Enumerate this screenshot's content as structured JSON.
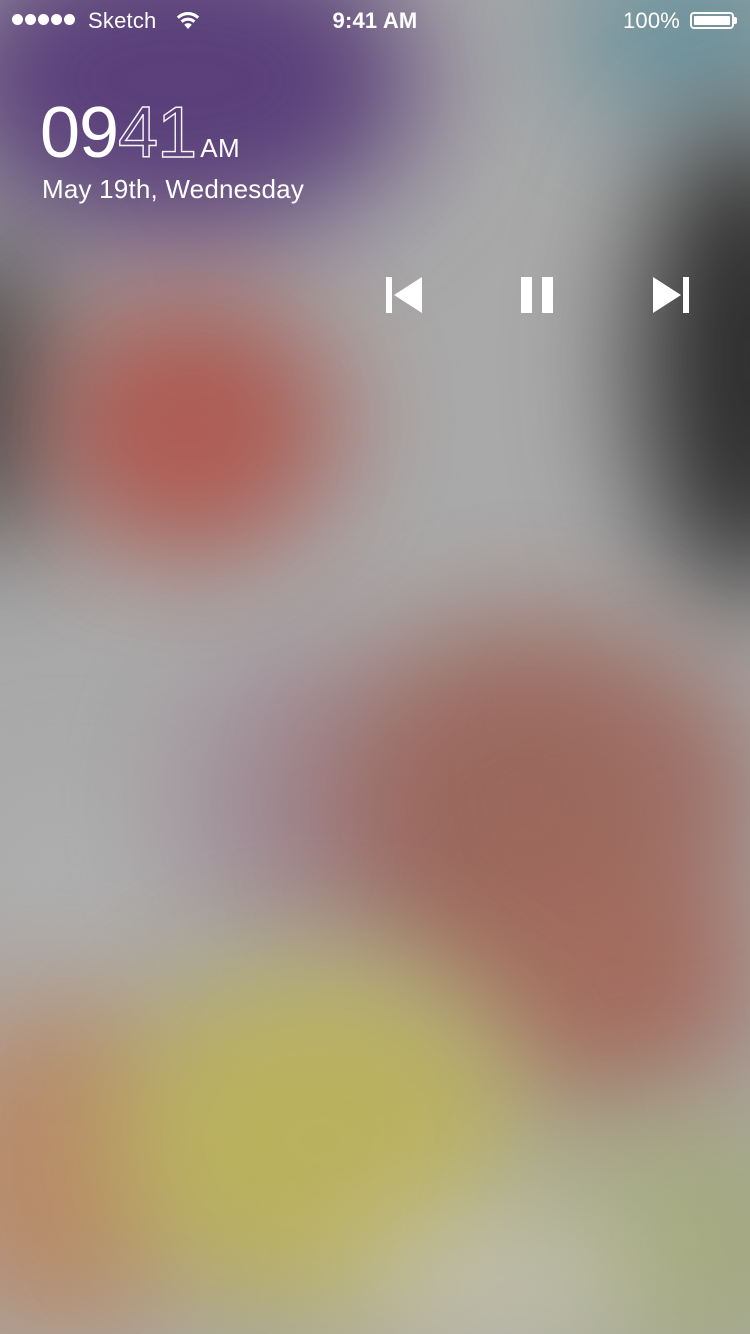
{
  "status_bar": {
    "carrier": "Sketch",
    "time": "9:41 AM",
    "battery_percent": "100%",
    "battery_level": 1.0,
    "signal_bars": 5,
    "icons": [
      "signal-dots-icon",
      "wifi-icon",
      "battery-icon"
    ]
  },
  "lockscreen": {
    "clock_hours": "09",
    "clock_minutes": "41",
    "clock_ampm": "AM",
    "date": "May 19th, Wednesday"
  },
  "media": {
    "controls": [
      {
        "name": "previous-track",
        "icon": "skip-back-icon"
      },
      {
        "name": "pause",
        "icon": "pause-icon"
      },
      {
        "name": "next-track",
        "icon": "skip-forward-icon"
      }
    ]
  },
  "colors": {
    "text": "#ffffff"
  }
}
